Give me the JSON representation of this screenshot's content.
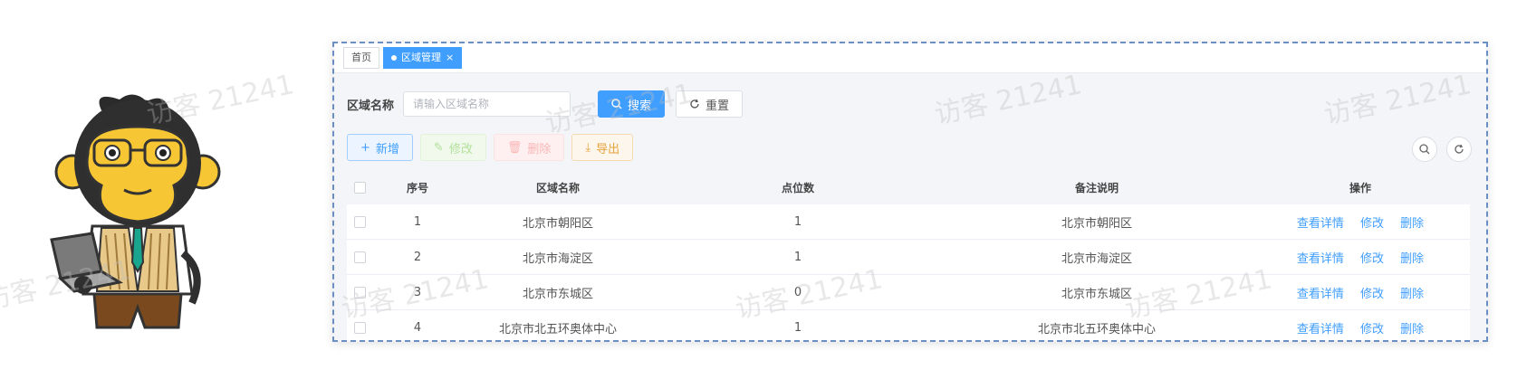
{
  "tabs": [
    {
      "label": "首页",
      "active": false
    },
    {
      "label": "区域管理",
      "active": true,
      "close": "×"
    }
  ],
  "search": {
    "label": "区域名称",
    "placeholder": "请输入区域名称",
    "value": "",
    "search_button": "搜索",
    "reset_button": "重置"
  },
  "toolbar": {
    "add": "新增",
    "edit": "修改",
    "delete": "删除",
    "export": "导出"
  },
  "table": {
    "headers": [
      "序号",
      "区域名称",
      "点位数",
      "备注说明",
      "操作"
    ],
    "rows": [
      {
        "index": "1",
        "name": "北京市朝阳区",
        "points": "1",
        "remark": "北京市朝阳区"
      },
      {
        "index": "2",
        "name": "北京市海淀区",
        "points": "1",
        "remark": "北京市海淀区"
      },
      {
        "index": "3",
        "name": "北京市东城区",
        "points": "0",
        "remark": "北京市东城区"
      },
      {
        "index": "4",
        "name": "北京市北五环奥体中心",
        "points": "1",
        "remark": "北京市北五环奥体中心"
      }
    ],
    "actions": {
      "view": "查看详情",
      "edit": "修改",
      "delete": "删除"
    }
  },
  "watermark": "访客 21241",
  "colors": {
    "primary": "#409eff",
    "frame_border": "#6b8fc4"
  }
}
